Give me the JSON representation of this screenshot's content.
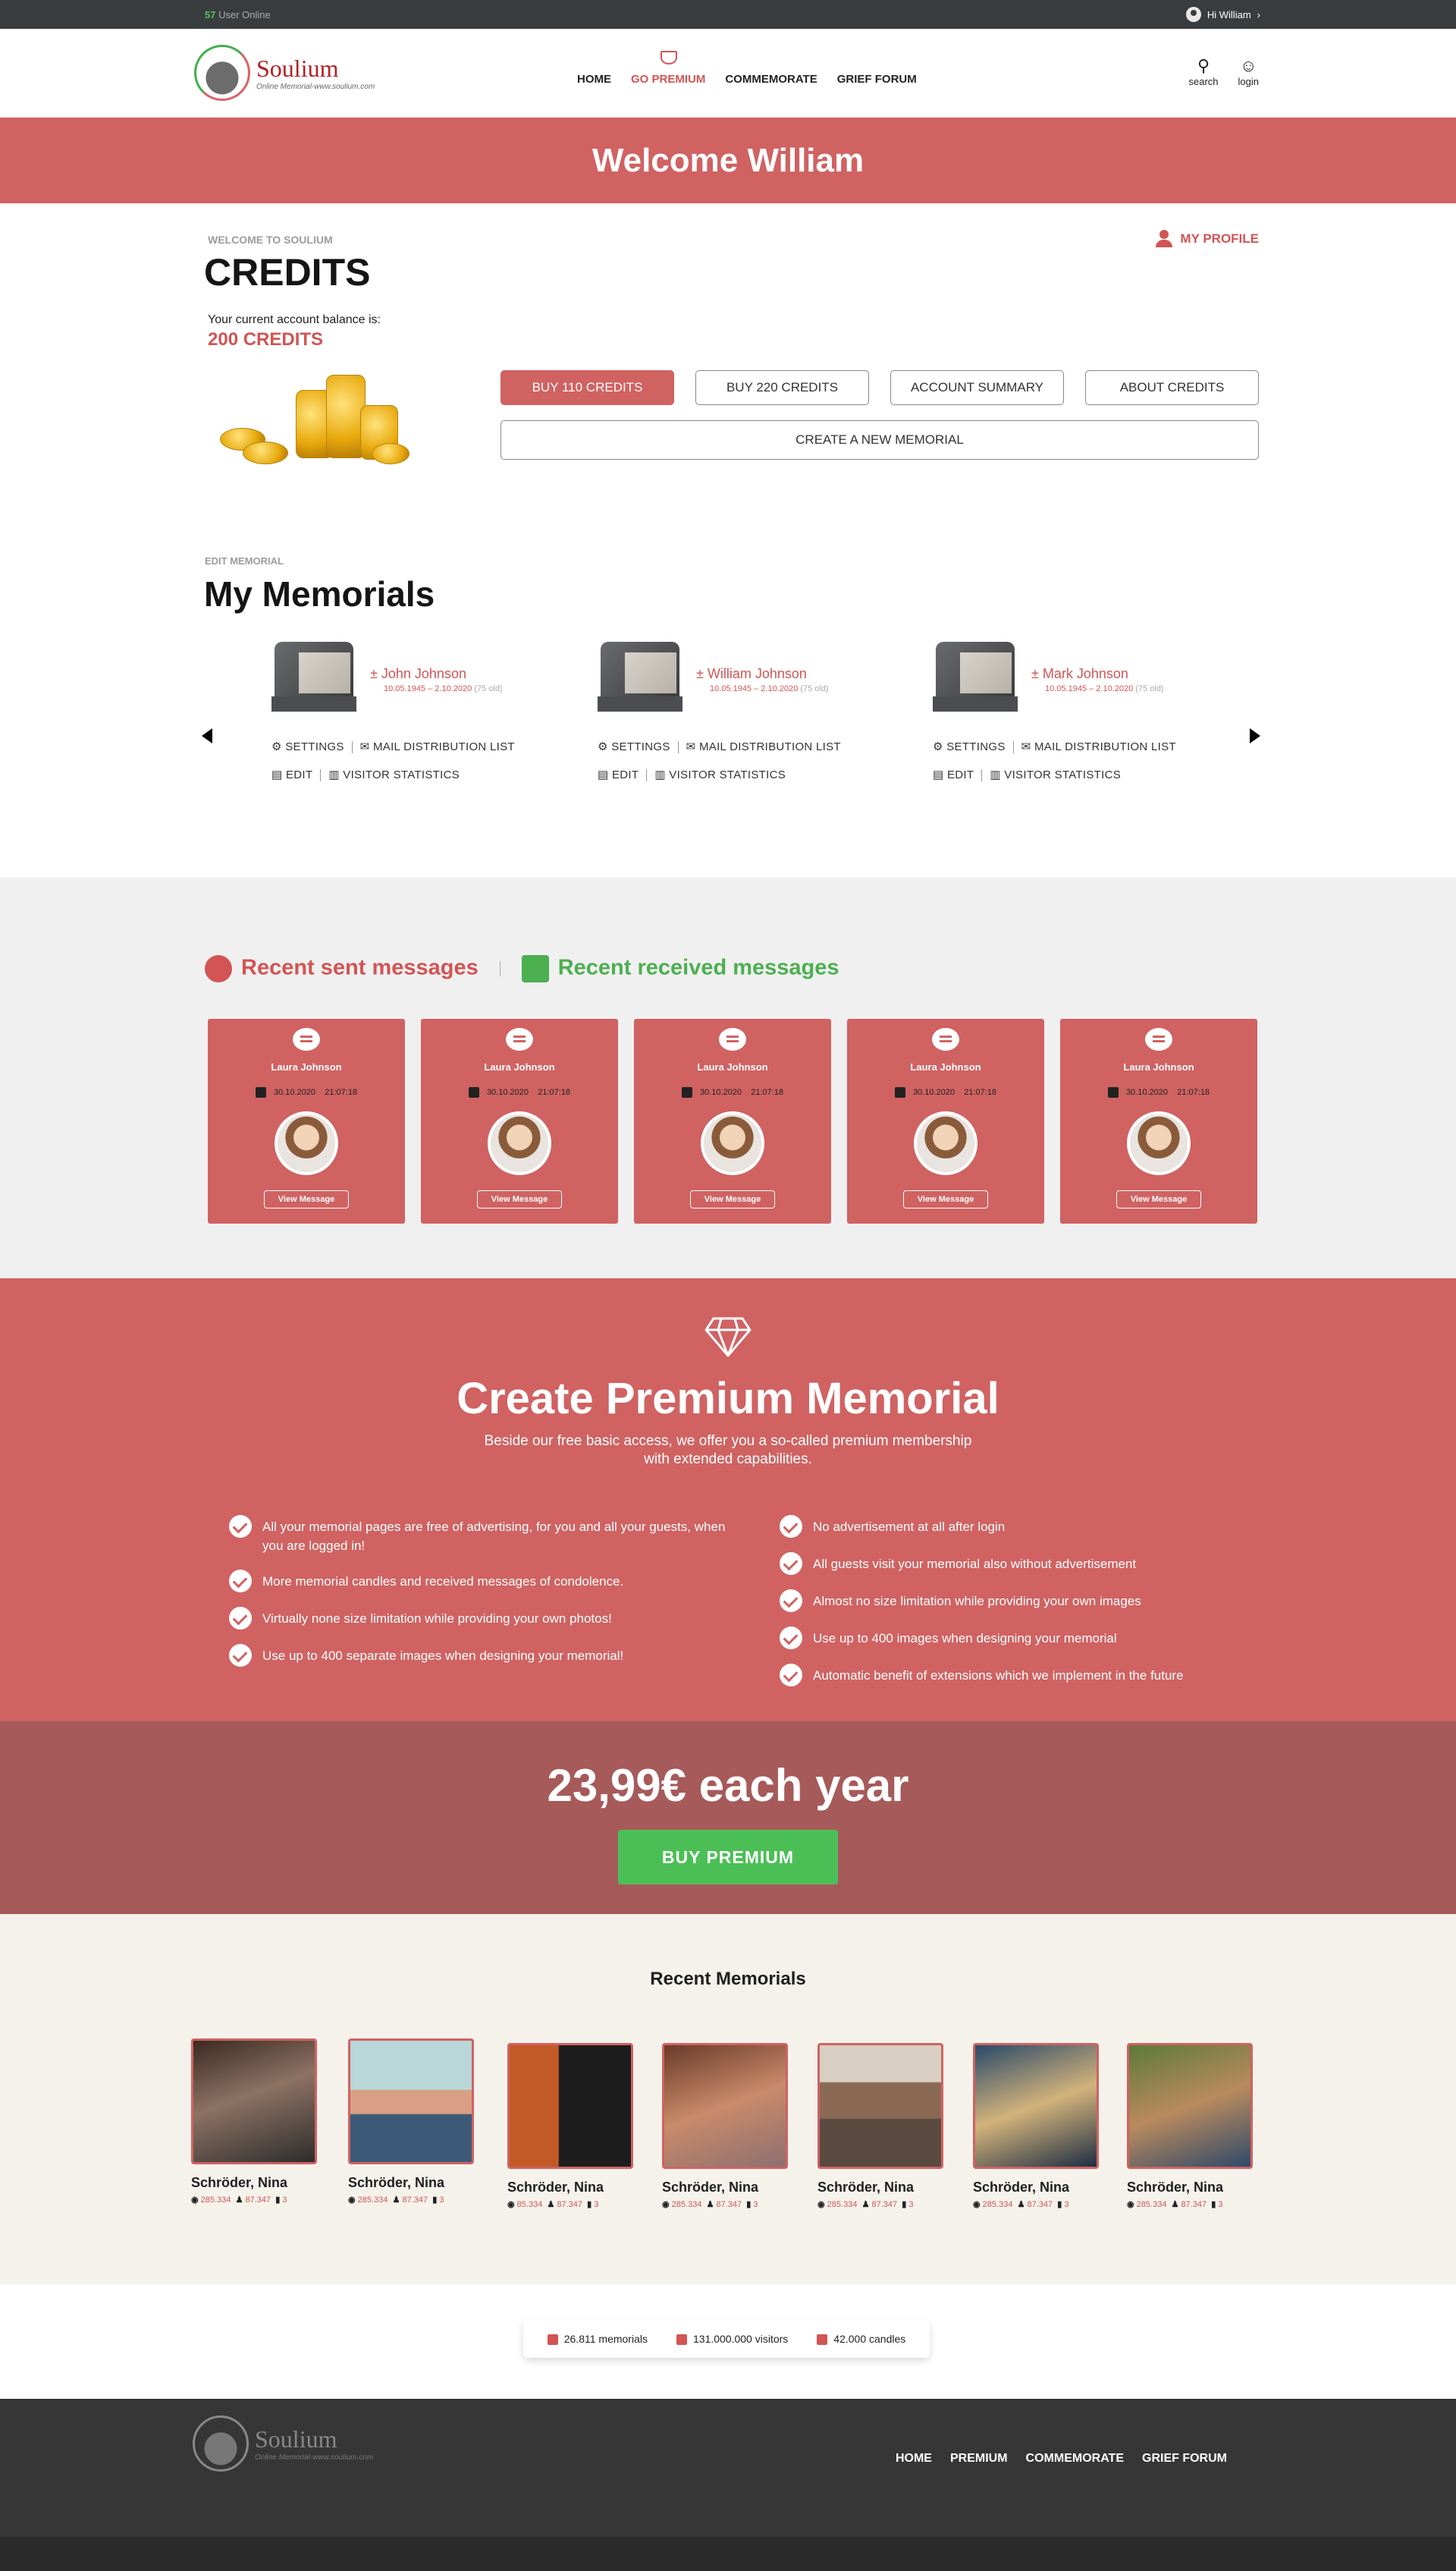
{
  "topbar": {
    "online_count": "57",
    "online_label": "User Online",
    "greeting": "Hi William",
    "chevron": "›"
  },
  "brand": {
    "name": "Soulium",
    "tagline": "Online Memorial-www.soulium.com"
  },
  "nav": {
    "home": "HOME",
    "premium": "GO PREMIUM",
    "commemorate": "COMMEMORATE",
    "forum": "GRIEF FORUM"
  },
  "header_icons": {
    "search": "search",
    "login": "login"
  },
  "welcome": "Welcome William",
  "credits": {
    "eyebrow": "WELCOME TO SOULIUM",
    "title": "CREDITS",
    "balance_label": "Your current account balance is:",
    "balance_value": "200 CREDITS",
    "my_profile": "MY PROFILE",
    "buttons": [
      "BUY 110 CREDITS",
      "BUY 220 CREDITS",
      "ACCOUNT SUMMARY",
      "ABOUT CREDITS"
    ],
    "create": "CREATE A NEW MEMORIAL"
  },
  "memorials": {
    "eyebrow": "EDIT MEMORIAL",
    "title": "My Memorials",
    "items": [
      {
        "name": "± John Johnson",
        "dates": "10.05.1945 – 2.10.2020",
        "age": "(75 old)"
      },
      {
        "name": "± William Johnson",
        "dates": "10.05.1945 – 2.10.2020",
        "age": "(75 old)"
      },
      {
        "name": "± Mark Johnson",
        "dates": "10.05.1945 – 2.10.2020",
        "age": "(75 old)"
      }
    ],
    "links": {
      "settings": "SETTINGS",
      "mail": "MAIL DISTRIBUTION LIST",
      "edit": "EDIT",
      "stats": "VISITOR STATISTICS"
    }
  },
  "messages": {
    "sent_tab": "Recent sent messages",
    "received_tab": "Recent received messages",
    "cards": [
      {
        "name": "Laura Johnson",
        "date": "30.10.2020",
        "time": "21:07:18",
        "button": "View Message"
      },
      {
        "name": "Laura Johnson",
        "date": "30.10.2020",
        "time": "21:07:18",
        "button": "View Message"
      },
      {
        "name": "Laura Johnson",
        "date": "30.10.2020",
        "time": "21:07:18",
        "button": "View Message"
      },
      {
        "name": "Laura Johnson",
        "date": "30.10.2020",
        "time": "21:07:18",
        "button": "View Message"
      },
      {
        "name": "Laura Johnson",
        "date": "30.10.2020",
        "time": "21:07:18",
        "button": "View Message"
      }
    ]
  },
  "premium": {
    "title": "Create Premium Memorial",
    "lead_1": "Beside our free basic access, we offer you a so-called premium membership",
    "lead_2": "with extended capabilities.",
    "left": [
      "All your memorial pages are free of advertising, for you and all your guests, when you are logged in!",
      "More memorial candles and received messages of condolence.",
      "Virtually none size limitation while providing your own photos!",
      "Use up to 400 separate images when designing your memorial!"
    ],
    "right": [
      "No advertisement at all after login",
      "All guests visit your memorial also without advertisement",
      "Almost no size limitation while providing your own images",
      "Use up to 400 images when designing your memorial",
      "Automatic benefit of extensions which we implement in the future"
    ],
    "price": "23,99€ each year",
    "buy": "BUY  PREMIUM"
  },
  "recent": {
    "title": "Recent Memorials",
    "items": [
      {
        "name": "Schröder, Nina",
        "views": "285.334",
        "candles": "87.347",
        "msgs": "3"
      },
      {
        "name": "Schröder, Nina",
        "views": "285.334",
        "candles": "87.347",
        "msgs": "3"
      },
      {
        "name": "Schröder, Nina",
        "views": "85.334",
        "candles": "87.347",
        "msgs": "3"
      },
      {
        "name": "Schröder, Nina",
        "views": "285.334",
        "candles": "87.347",
        "msgs": "3"
      },
      {
        "name": "Schröder, Nina",
        "views": "285.334",
        "candles": "87.347",
        "msgs": "3"
      },
      {
        "name": "Schröder, Nina",
        "views": "285.334",
        "candles": "87.347",
        "msgs": "3"
      },
      {
        "name": "Schröder, Nina",
        "views": "285.334",
        "candles": "87.347",
        "msgs": "3"
      }
    ]
  },
  "stats": {
    "memorials": "26.811 memorials",
    "visitors": "131.000.000 visitors",
    "candles": "42.000 candles"
  },
  "footer_nav": {
    "home": "HOME",
    "premium": "PREMIUM",
    "commemorate": "COMMEMORATE",
    "forum": "GRIEF FORUM"
  },
  "colors": {
    "accent": "#d06262",
    "green": "#4bbf56",
    "dark": "#3a3d40"
  }
}
